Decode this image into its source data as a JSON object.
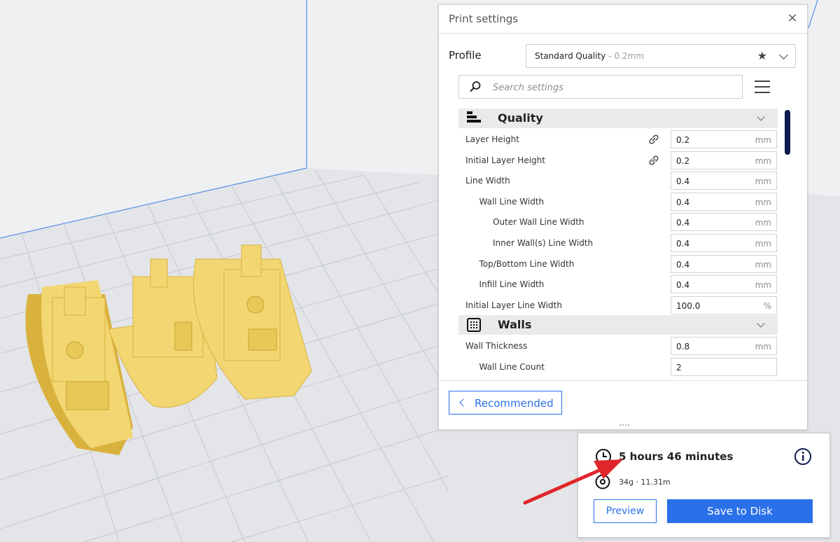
{
  "print_settings": {
    "title": "Print settings",
    "close_glyph": "×",
    "profile_label": "Profile",
    "profile_name": "Standard Quality",
    "profile_sub": "- 0.2mm",
    "search_placeholder": "Search settings",
    "categories": [
      {
        "label": "Quality",
        "icon": "quality-bars-icon",
        "settings": [
          {
            "label": "Layer Height",
            "value": "0.2",
            "unit": "mm",
            "linked": true,
            "indent": 0
          },
          {
            "label": "Initial Layer Height",
            "value": "0.2",
            "unit": "mm",
            "linked": true,
            "indent": 0
          },
          {
            "label": "Line Width",
            "value": "0.4",
            "unit": "mm",
            "linked": false,
            "indent": 0
          },
          {
            "label": "Wall Line Width",
            "value": "0.4",
            "unit": "mm",
            "linked": false,
            "indent": 1
          },
          {
            "label": "Outer Wall Line Width",
            "value": "0.4",
            "unit": "mm",
            "linked": false,
            "indent": 2
          },
          {
            "label": "Inner Wall(s) Line Width",
            "value": "0.4",
            "unit": "mm",
            "linked": false,
            "indent": 2
          },
          {
            "label": "Top/Bottom Line Width",
            "value": "0.4",
            "unit": "mm",
            "linked": false,
            "indent": 1
          },
          {
            "label": "Infill Line Width",
            "value": "0.4",
            "unit": "mm",
            "linked": false,
            "indent": 1
          },
          {
            "label": "Initial Layer Line Width",
            "value": "100.0",
            "unit": "%",
            "linked": false,
            "indent": 0
          }
        ]
      },
      {
        "label": "Walls",
        "icon": "walls-grid-icon",
        "settings": [
          {
            "label": "Wall Thickness",
            "value": "0.8",
            "unit": "mm",
            "linked": false,
            "indent": 0
          },
          {
            "label": "Wall Line Count",
            "value": "2",
            "unit": "",
            "linked": false,
            "indent": 1
          }
        ]
      }
    ],
    "recommended_label": "Recommended"
  },
  "estimate": {
    "time": "5 hours 46 minutes",
    "material": "34g · 11.31m",
    "preview_label": "Preview",
    "save_label": "Save to Disk"
  },
  "colors": {
    "accent": "#2a70e8",
    "model": "#f2d671",
    "model_shadow": "#d9b23e",
    "scrollbar": "#0e1a4b",
    "arrow": "#e0262b",
    "grid_line": "#c6c9cd"
  }
}
